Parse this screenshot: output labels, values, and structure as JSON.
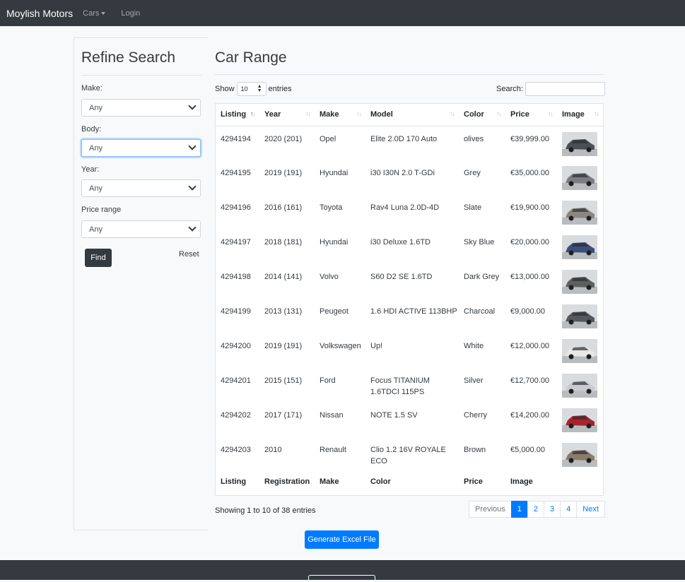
{
  "navbar": {
    "brand": "Moylish Motors",
    "cars_label": "Cars",
    "login_label": "Login"
  },
  "sidebar": {
    "title": "Refine Search",
    "filters": [
      {
        "label": "Make:",
        "value": "Any"
      },
      {
        "label": "Body:",
        "value": "Any"
      },
      {
        "label": "Year:",
        "value": "Any"
      },
      {
        "label": "Price range",
        "value": "Any"
      }
    ],
    "find_label": "Find",
    "reset_label": "Reset"
  },
  "main": {
    "title": "Car Range",
    "show_label": "Show",
    "entries_value": "10",
    "entries_label": "entries",
    "search_label": "Search:",
    "search_value": ""
  },
  "table": {
    "headers": [
      "Listing",
      "Year",
      "Make",
      "Model",
      "Color",
      "Price",
      "Image"
    ],
    "footers": [
      "Listing",
      "Registration",
      "Make",
      "Color",
      "Price",
      "Image",
      ""
    ],
    "rows": [
      {
        "listing": "4294194",
        "year": "2020 (201)",
        "make": "Opel",
        "model": "Elite 2.0D 170 Auto",
        "color": "olives",
        "price": "€39,999.00",
        "car_color": "#4a4f55"
      },
      {
        "listing": "4294195",
        "year": "2019 (191)",
        "make": "Hyundai",
        "model": "i30 I30N 2.0 T-GDi",
        "color": "Grey",
        "price": "€35,000.00",
        "car_color": "#7a7d82"
      },
      {
        "listing": "4294196",
        "year": "2016 (161)",
        "make": "Toyota",
        "model": "Rav4 Luna 2.0D-4D",
        "color": "Slate",
        "price": "€19,900.00",
        "car_color": "#8a8780"
      },
      {
        "listing": "4294197",
        "year": "2018 (181)",
        "make": "Hyundai",
        "model": "i30 Deluxe 1.6TD",
        "color": "Sky Blue",
        "price": "€20,000.00",
        "car_color": "#3b4f78"
      },
      {
        "listing": "4294198",
        "year": "2014 (141)",
        "make": "Volvo",
        "model": "S60 D2 SE 1.6TD",
        "color": "Dark Grey",
        "price": "€13,000.00",
        "car_color": "#5c605f"
      },
      {
        "listing": "4294199",
        "year": "2013 (131)",
        "make": "Peugeot",
        "model": "1.6 HDI ACTIVE 113BHP",
        "color": "Charcoal",
        "price": "€9,000.00",
        "car_color": "#55585c"
      },
      {
        "listing": "4294200",
        "year": "2019 (191)",
        "make": "Volkswagen",
        "model": "Up!",
        "color": "White",
        "price": "€12,000.00",
        "car_color": "#e8e8e8"
      },
      {
        "listing": "4294201",
        "year": "2015 (151)",
        "make": "Ford",
        "model": "Focus TITANIUM 1.6TDCI 115PS",
        "color": "Silver",
        "price": "€12,700.00",
        "car_color": "#c8cbd0"
      },
      {
        "listing": "4294202",
        "year": "2017 (171)",
        "make": "Nissan",
        "model": "NOTE 1.5 SV",
        "color": "Cherry",
        "price": "€14,200.00",
        "car_color": "#a8232c"
      },
      {
        "listing": "4294203",
        "year": "2010",
        "make": "Renault",
        "model": "Clio 1.2 16V ROYALE ECO",
        "color": "Brown",
        "price": "€5,000.00",
        "car_color": "#8b7b6a"
      }
    ]
  },
  "footer_info": {
    "showing": "Showing 1 to 10 of 38 entries",
    "pages": [
      "Previous",
      "1",
      "2",
      "3",
      "4",
      "Next"
    ],
    "active_page": "1"
  },
  "excel_label": "Generate Excel File",
  "colors": {
    "navbar": "#343a40",
    "primary": "#007bff"
  }
}
